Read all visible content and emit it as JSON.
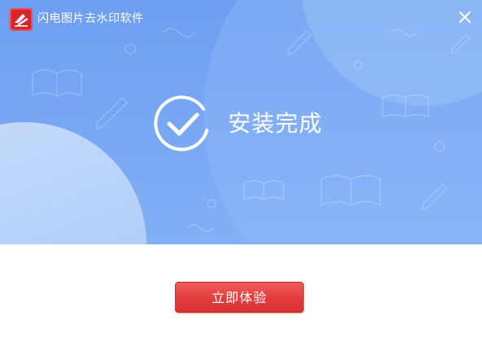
{
  "window": {
    "title": "闪电图片去水印软件",
    "app_icon": "lightning-logo-icon",
    "close_icon": "close-icon"
  },
  "status": {
    "icon": "check-circle-icon",
    "text": "安装完成"
  },
  "actions": {
    "primary_label": "立即体验"
  },
  "colors": {
    "hero_background": "#76a6f3",
    "primary_button": "#e33d3d",
    "text_on_hero": "#ffffff"
  }
}
